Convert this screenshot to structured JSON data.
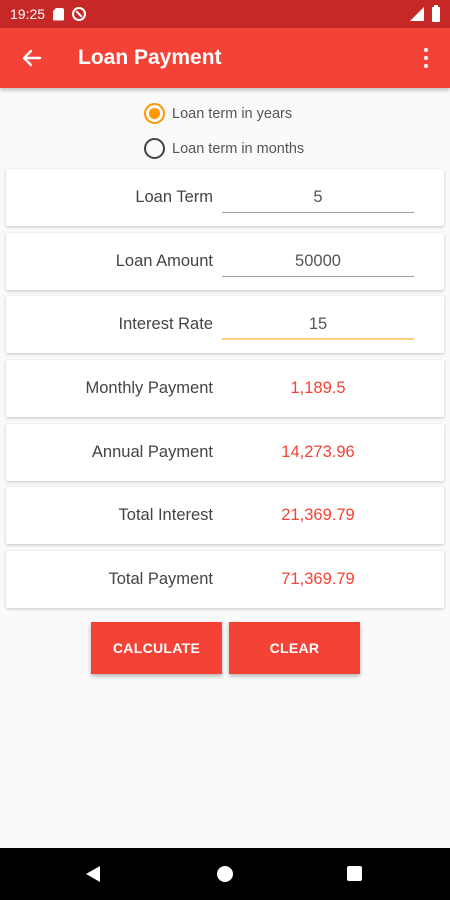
{
  "status_bar": {
    "time": "19:25"
  },
  "app_bar": {
    "title": "Loan Payment"
  },
  "term_options": {
    "years_label": "Loan term in years",
    "months_label": "Loan term in months",
    "selected": "years"
  },
  "fields": {
    "loan_term": {
      "label": "Loan Term",
      "value": "5"
    },
    "loan_amount": {
      "label": "Loan Amount",
      "value": "50000"
    },
    "interest_rate": {
      "label": "Interest Rate",
      "value": "15"
    }
  },
  "results": {
    "monthly_payment": {
      "label": "Monthly Payment",
      "value": "1,189.5"
    },
    "annual_payment": {
      "label": "Annual Payment",
      "value": "14,273.96"
    },
    "total_interest": {
      "label": "Total Interest",
      "value": "21,369.79"
    },
    "total_payment": {
      "label": "Total Payment",
      "value": "71,369.79"
    }
  },
  "buttons": {
    "calculate": "CALCULATE",
    "clear": "CLEAR"
  },
  "colors": {
    "primary": "#f44336",
    "primary_dark": "#c62828",
    "accent": "#ff9800",
    "result_text": "#f44336"
  }
}
